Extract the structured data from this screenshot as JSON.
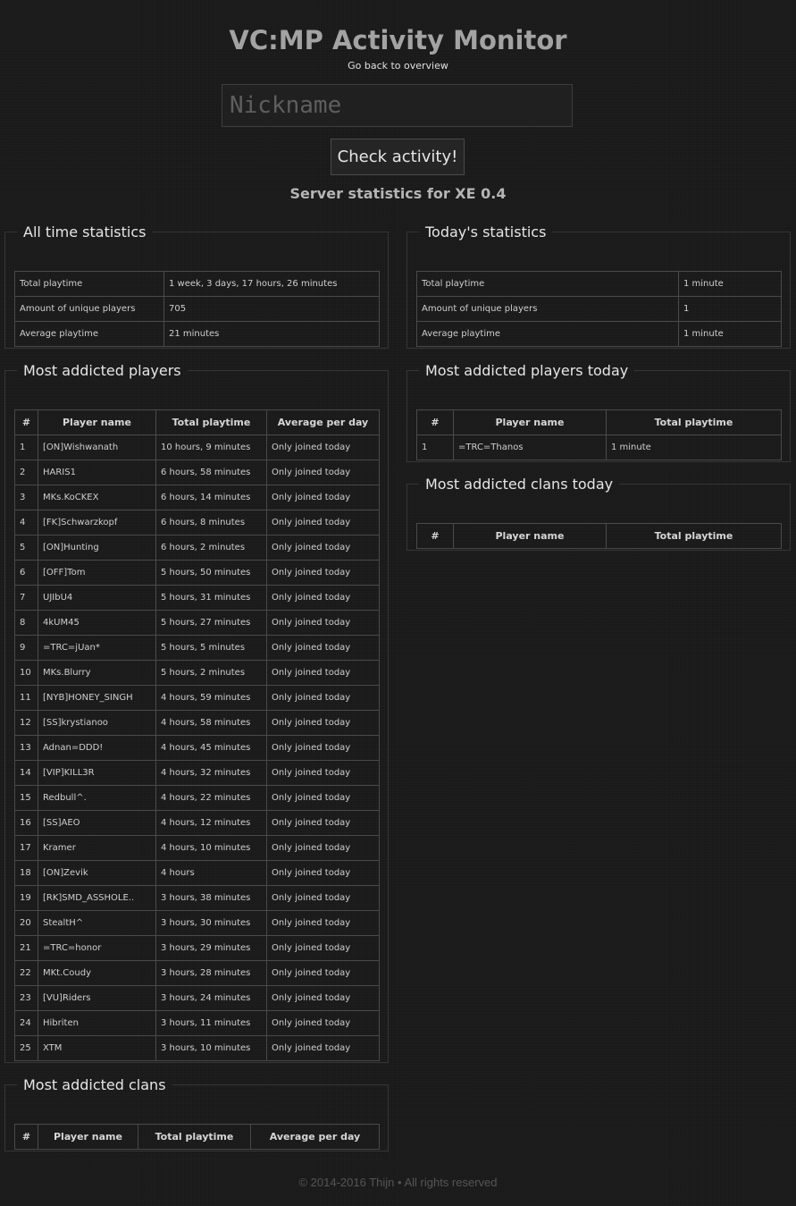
{
  "header": {
    "title": "VC:MP Activity Monitor",
    "back_link": "Go back to overview"
  },
  "search": {
    "placeholder": "Nickname",
    "button_label": "Check activity!"
  },
  "server_heading": "Server statistics for XE 0.4",
  "all_time": {
    "title": "All time statistics",
    "rows": [
      [
        "Total playtime",
        "1 week, 3 days, 17 hours, 26 minutes"
      ],
      [
        "Amount of unique players",
        "705"
      ],
      [
        "Average playtime",
        "21 minutes"
      ]
    ]
  },
  "today": {
    "title": "Today's statistics",
    "rows": [
      [
        "Total playtime",
        "1 minute"
      ],
      [
        "Amount of unique players",
        "1"
      ],
      [
        "Average playtime",
        "1 minute"
      ]
    ]
  },
  "addicted_players": {
    "title": "Most addicted players",
    "columns": [
      "#",
      "Player name",
      "Total playtime",
      "Average per day"
    ],
    "rows": [
      [
        "1",
        "[ON]Wishwanath",
        "10 hours, 9 minutes",
        "Only joined today"
      ],
      [
        "2",
        "HARIS1",
        "6 hours, 58 minutes",
        "Only joined today"
      ],
      [
        "3",
        "MKs.KoCKEX",
        "6 hours, 14 minutes",
        "Only joined today"
      ],
      [
        "4",
        "[FK]Schwarzkopf",
        "6 hours, 8 minutes",
        "Only joined today"
      ],
      [
        "5",
        "[ON]Hunting",
        "6 hours, 2 minutes",
        "Only joined today"
      ],
      [
        "6",
        "[OFF]Tom",
        "5 hours, 50 minutes",
        "Only joined today"
      ],
      [
        "7",
        "UJIbU4",
        "5 hours, 31 minutes",
        "Only joined today"
      ],
      [
        "8",
        "4kUM45",
        "5 hours, 27 minutes",
        "Only joined today"
      ],
      [
        "9",
        "=TRC=jUan*",
        "5 hours, 5 minutes",
        "Only joined today"
      ],
      [
        "10",
        "MKs.Blurry",
        "5 hours, 2 minutes",
        "Only joined today"
      ],
      [
        "11",
        "[NYB]HONEY_SINGH",
        "4 hours, 59 minutes",
        "Only joined today"
      ],
      [
        "12",
        "[SS]krystianoo",
        "4 hours, 58 minutes",
        "Only joined today"
      ],
      [
        "13",
        "Adnan=DDD!",
        "4 hours, 45 minutes",
        "Only joined today"
      ],
      [
        "14",
        "[VIP]KILL3R",
        "4 hours, 32 minutes",
        "Only joined today"
      ],
      [
        "15",
        "Redbull^.",
        "4 hours, 22 minutes",
        "Only joined today"
      ],
      [
        "16",
        "[SS]AEO",
        "4 hours, 12 minutes",
        "Only joined today"
      ],
      [
        "17",
        "Kramer",
        "4 hours, 10 minutes",
        "Only joined today"
      ],
      [
        "18",
        "[ON]Zevik",
        "4 hours",
        "Only joined today"
      ],
      [
        "19",
        "[RK]SMD_ASSHOLE..",
        "3 hours, 38 minutes",
        "Only joined today"
      ],
      [
        "20",
        "StealtH^",
        "3 hours, 30 minutes",
        "Only joined today"
      ],
      [
        "21",
        "=TRC=honor",
        "3 hours, 29 minutes",
        "Only joined today"
      ],
      [
        "22",
        "MKt.Coudy",
        "3 hours, 28 minutes",
        "Only joined today"
      ],
      [
        "23",
        "[VU]Riders",
        "3 hours, 24 minutes",
        "Only joined today"
      ],
      [
        "24",
        "Hibriten",
        "3 hours, 11 minutes",
        "Only joined today"
      ],
      [
        "25",
        "XTM",
        "3 hours, 10 minutes",
        "Only joined today"
      ]
    ]
  },
  "addicted_clans": {
    "title": "Most addicted clans",
    "columns": [
      "#",
      "Player name",
      "Total playtime",
      "Average per day"
    ],
    "rows": []
  },
  "addicted_players_today": {
    "title": "Most addicted players today",
    "columns": [
      "#",
      "Player name",
      "Total playtime"
    ],
    "rows": [
      [
        "1",
        "=TRC=Thanos",
        "1 minute"
      ]
    ]
  },
  "addicted_clans_today": {
    "title": "Most addicted clans today",
    "columns": [
      "#",
      "Player name",
      "Total playtime"
    ],
    "rows": []
  },
  "footer": "© 2014-2016 Thijn • All rights reserved"
}
